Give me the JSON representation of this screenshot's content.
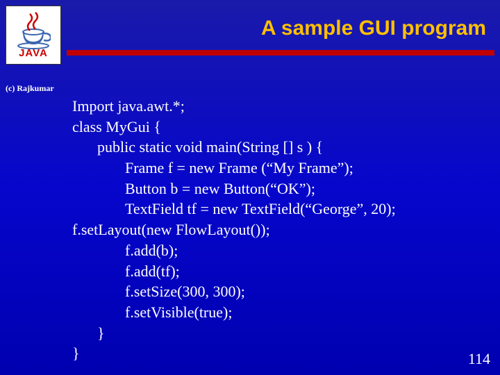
{
  "logo": {
    "label": "JAVA"
  },
  "title": "A sample GUI program",
  "credit": "(c) Rajkumar",
  "code": {
    "l1": "Import java.awt.*;",
    "l2": "class MyGui {",
    "l3": "public static void main(String [] s ) {",
    "l4": "Frame f = new  Frame (“My Frame”);",
    "l5": "Button b = new Button(“OK”);",
    "l6": "TextField tf = new TextField(“George”, 20);",
    "l7": "f.setLayout(new FlowLayout());",
    "l8": "f.add(b);",
    "l9": "f.add(tf);",
    "l10": "f.setSize(300, 300);",
    "l11": "f.setVisible(true);",
    "l12": "}",
    "l13": "}"
  },
  "page_number": "114"
}
